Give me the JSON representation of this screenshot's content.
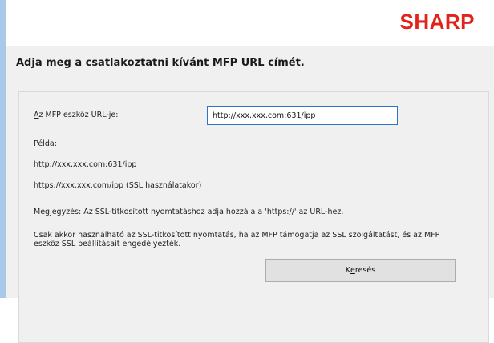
{
  "header": {
    "logo": "SHARP"
  },
  "title": "Adja meg a csatlakoztatni kívánt MFP URL címét.",
  "form": {
    "url_label_accesskey": "A",
    "url_label_rest": "z MFP eszköz URL-je:",
    "url_value": "http://xxx.xxx.com:631/ipp",
    "example_heading": "Példa:",
    "example_http": "http://xxx.xxx.com:631/ipp",
    "example_https": "https://xxx.xxx.com/ipp (SSL használatakor)",
    "note": "Megjegyzés: Az SSL-titkosított nyomtatáshoz adja hozzá a a 'https://' az URL-hez.",
    "ssl_info_line1": "Csak akkor használható az SSL-titkosított nyomtatás, ha az MFP támogatja az SSL szolgáltatást, és az MFP",
    "ssl_info_line2": "eszköz SSL beállításait engedélyezték.",
    "search_button_pre": "K",
    "search_button_accesskey": "e",
    "search_button_post": "resés"
  },
  "colors": {
    "brand": "#e2231a",
    "input_border": "#2a75c8",
    "window_bg": "#f0f0f0"
  }
}
